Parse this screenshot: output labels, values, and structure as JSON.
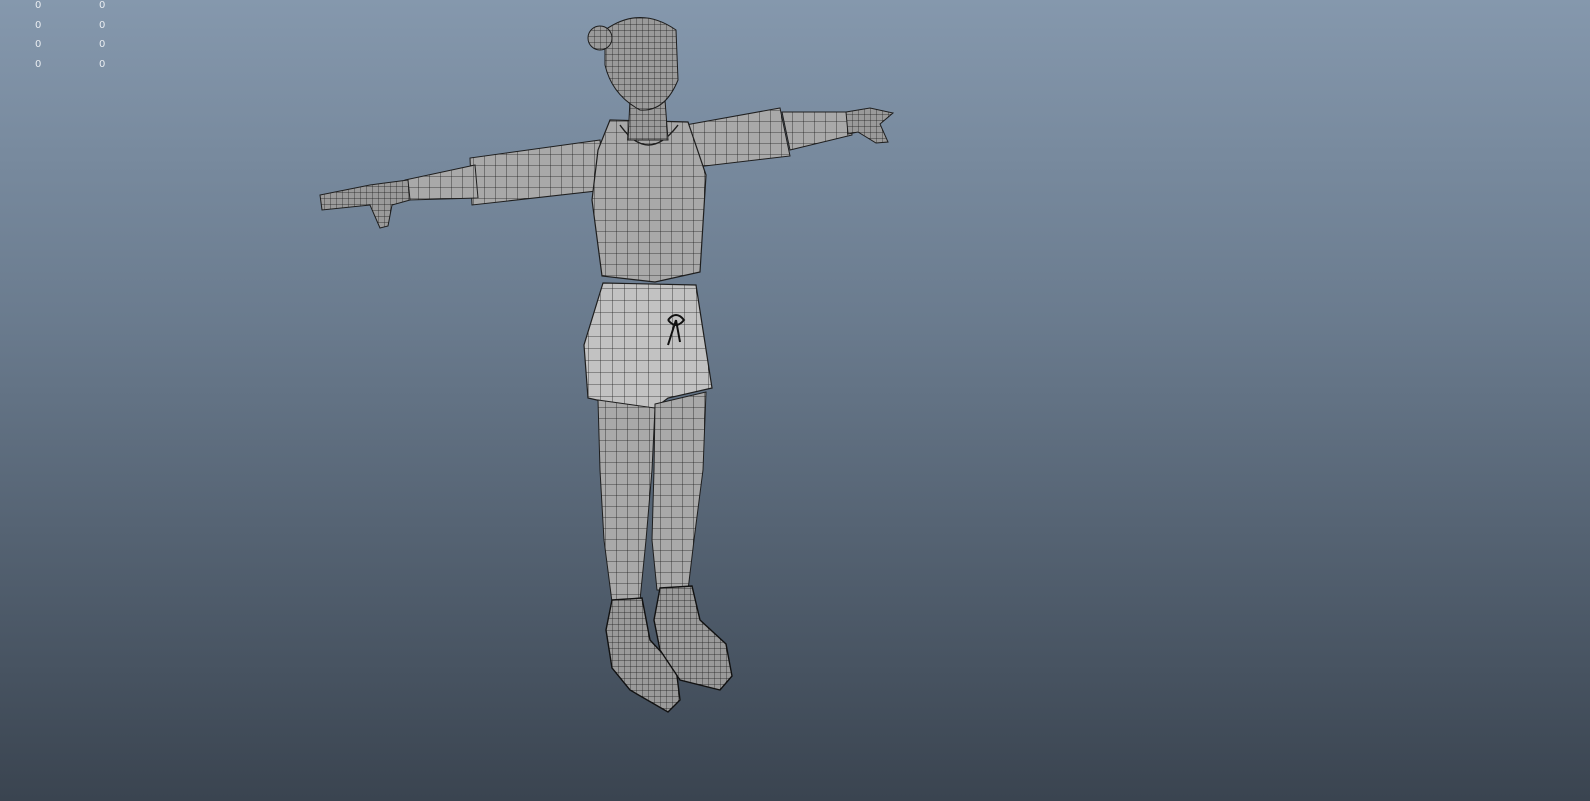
{
  "viewport": {
    "background_top": "#8598ad",
    "background_bottom": "#3a4450",
    "mesh_fill": "#a9a9a9",
    "wire_color": "#1e1e1e"
  },
  "hud": {
    "rows": [
      {
        "a": "0",
        "b": "0"
      },
      {
        "a": "0",
        "b": "0"
      },
      {
        "a": "0",
        "b": "0"
      },
      {
        "a": "0",
        "b": "0"
      }
    ]
  }
}
